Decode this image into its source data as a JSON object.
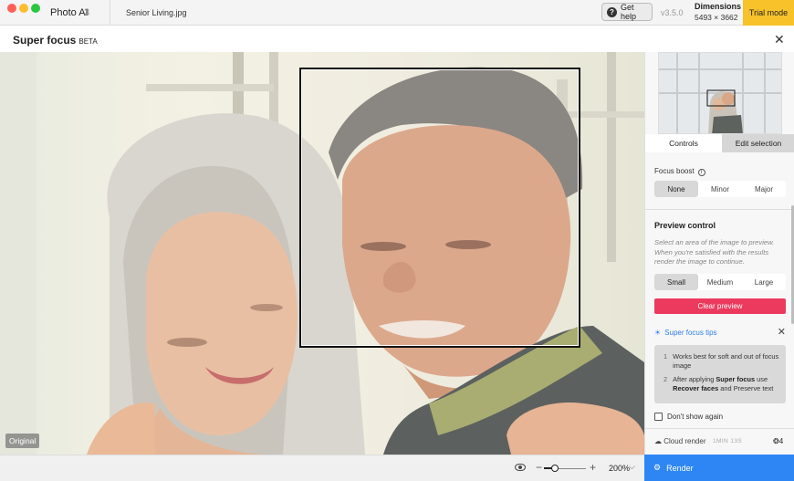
{
  "titlebar": {
    "app_name": "Photo AI",
    "app_version": "3",
    "file_name": "Senior Living.jpg",
    "help_label": "Get help",
    "version": "v3.5.0",
    "dimensions_label": "Dimensions",
    "dimensions_value": "5493 × 3662",
    "trial_label": "Trial mode"
  },
  "header": {
    "title": "Super focus",
    "badge": "BETA"
  },
  "preview": {
    "original_badge": "Original"
  },
  "bottombar": {
    "zoom_minus": "−",
    "zoom_plus": "+",
    "zoom_level": "200%",
    "zoom_slider_fraction": 0.25
  },
  "sidebar": {
    "tabs": {
      "controls": "Controls",
      "edit": "Edit selection"
    },
    "focus_boost": {
      "label": "Focus boost",
      "options": [
        "None",
        "Minor",
        "Major"
      ],
      "selected": "None"
    },
    "preview_control": {
      "title": "Preview control",
      "description": "Select an area of the image to preview. When you're satisfied with the results render the image to continue.",
      "sizes": [
        "Small",
        "Medium",
        "Large"
      ],
      "selected": "Small",
      "clear_label": "Clear preview"
    },
    "tips": {
      "title": "Super focus tips",
      "items": [
        {
          "num": "1",
          "text": "Works best for soft and out of focus image"
        },
        {
          "num": "2",
          "pre": "After applying ",
          "b1": "Super focus",
          "mid1": " use ",
          "b2": "Recover faces",
          "mid2": " and ",
          "post": "Preserve text"
        }
      ]
    },
    "dont_show": "Don't show again",
    "cloud_label": "Cloud render",
    "cloud_time": "1MIN 13S",
    "credits": "4",
    "render_label": "Render"
  },
  "colors": {
    "trial_bg": "#f7c22a",
    "clear_btn": "#ec3a5e",
    "render_btn": "#2e86f5",
    "tips_link": "#2e7ee8"
  }
}
